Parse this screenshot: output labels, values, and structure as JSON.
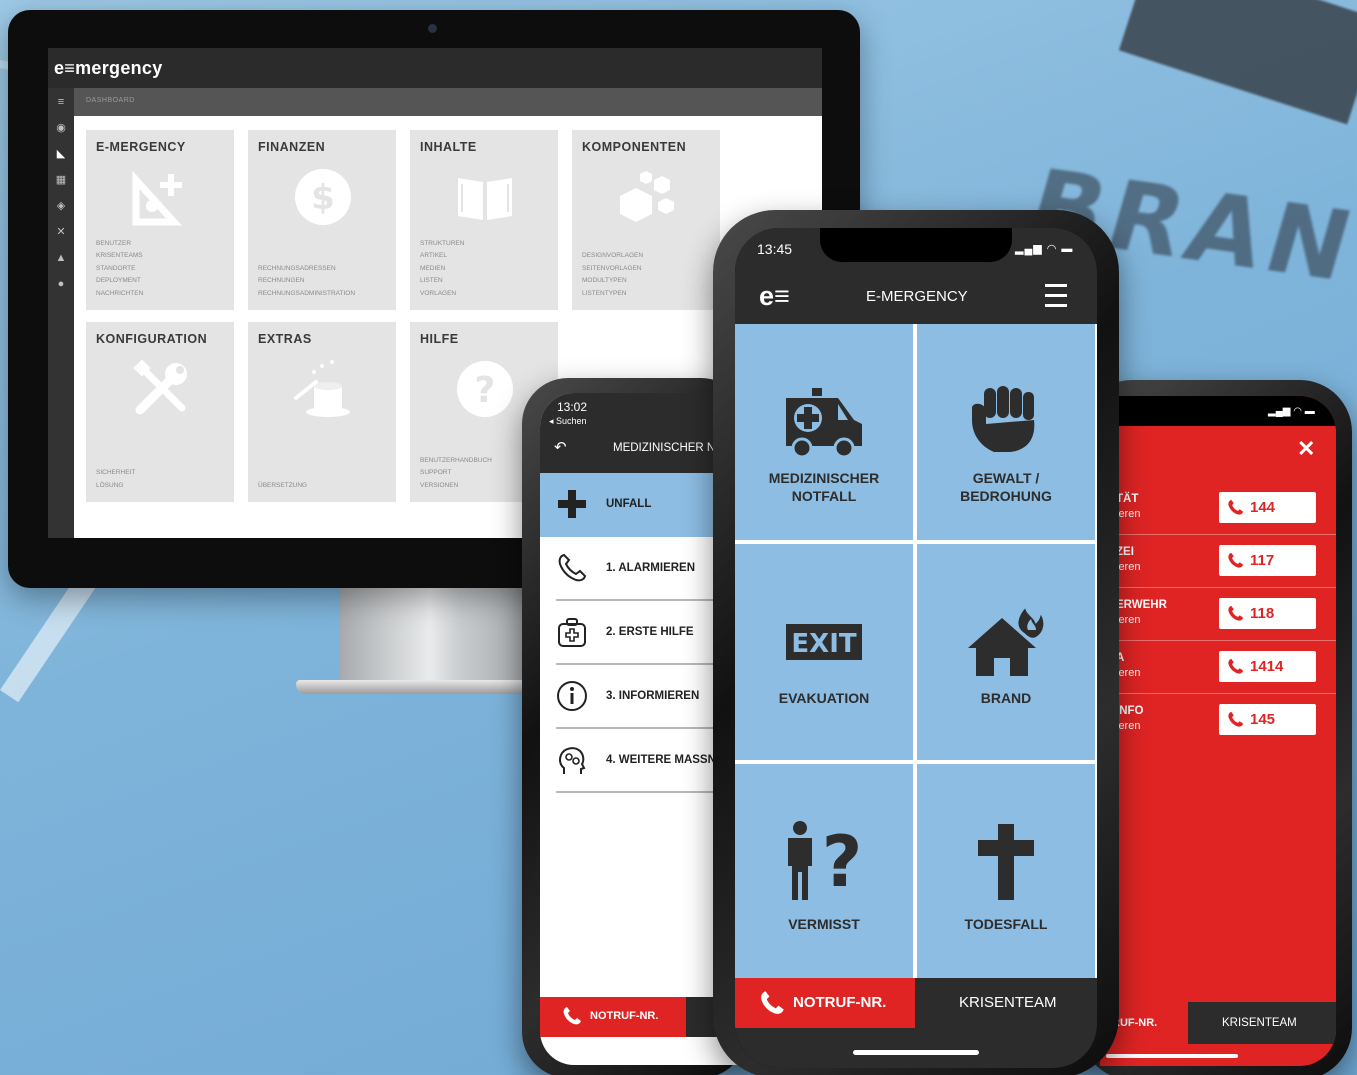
{
  "background": {
    "sign_text": "BRAN"
  },
  "desktop": {
    "logo": "e≡mergency",
    "breadcrumb": "DASHBOARD",
    "tiles": [
      {
        "title": "E-MERGENCY",
        "icon": "user-plus-icon",
        "links": [
          "BENUTZER",
          "KRISENTEAMS",
          "STANDORTE",
          "DEPLOYMENT",
          "NACHRICHTEN"
        ]
      },
      {
        "title": "FINANZEN",
        "icon": "dollar-icon",
        "links": [
          "RECHNUNGSADRESSEN",
          "RECHNUNGEN",
          "RECHNUNGSADMINISTRATION"
        ]
      },
      {
        "title": "INHALTE",
        "icon": "book-icon",
        "links": [
          "STRUKTUREN",
          "ARTIKEL",
          "MEDIEN",
          "LISTEN",
          "VORLAGEN"
        ]
      },
      {
        "title": "KOMPONENTEN",
        "icon": "cubes-icon",
        "links": [
          "DESIGNVORLAGEN",
          "SEITENVORLAGEN",
          "MODULTYPEN",
          "LISTENTYPEN"
        ]
      },
      {
        "title": "KONFIGURATION",
        "icon": "tools-icon",
        "links": [
          "SICHERHEIT",
          "LÖSUNG"
        ]
      },
      {
        "title": "EXTRAS",
        "icon": "magic-hat-icon",
        "links": [
          "ÜBERSETZUNG"
        ]
      },
      {
        "title": "HILFE",
        "icon": "question-icon",
        "links": [
          "BENUTZERHANDBUCH",
          "SUPPORT",
          "VERSIONEN"
        ]
      }
    ]
  },
  "left_phone": {
    "time": "13:02",
    "back_label": "◂ Suchen",
    "title": "MEDIZINISCHER N",
    "rows": [
      {
        "label": "UNFALL",
        "icon": "plus-icon",
        "active": true
      },
      {
        "label": "1. ALARMIEREN",
        "icon": "phone-icon",
        "active": false
      },
      {
        "label": "2. ERSTE HILFE",
        "icon": "first-aid-kit-icon",
        "active": false
      },
      {
        "label": "3. INFORMIEREN",
        "icon": "info-icon",
        "active": false
      },
      {
        "label": "4. WEITERE MASSN",
        "icon": "head-gears-icon",
        "active": false
      }
    ],
    "footer_notruf": "NOTRUF-NR."
  },
  "center_phone": {
    "time": "13:45",
    "logo": "e≡",
    "title": "E-MERGENCY",
    "cells": [
      {
        "label_1": "MEDIZINISCHER",
        "label_2": "NOTFALL",
        "icon": "ambulance-icon"
      },
      {
        "label_1": "GEWALT /",
        "label_2": "BEDROHUNG",
        "icon": "fist-icon"
      },
      {
        "label_1": "EVAKUATION",
        "label_2": "",
        "icon": "exit-sign-icon"
      },
      {
        "label_1": "BRAND",
        "label_2": "",
        "icon": "house-fire-icon"
      },
      {
        "label_1": "VERMISST",
        "label_2": "",
        "icon": "person-question-icon"
      },
      {
        "label_1": "TODESFALL",
        "label_2": "",
        "icon": "cross-icon"
      }
    ],
    "exit_text": "EXIT",
    "footer_notruf": "NOTRUF-NR.",
    "footer_krisenteam": "KRISENTEAM"
  },
  "right_phone": {
    "close_label": "✕",
    "rows": [
      {
        "name": "TÄT",
        "sub": "ieren",
        "number": "144"
      },
      {
        "name": "ZEI",
        "sub": "ieren",
        "number": "117"
      },
      {
        "name": "ERWEHR",
        "sub": "ieren",
        "number": "118"
      },
      {
        "name": "A",
        "sub": "ieren",
        "number": "1414"
      },
      {
        "name": "INFO",
        "sub": "ieren",
        "number": "145"
      }
    ],
    "footer_left": "RUF-NR.",
    "footer_right": "KRISENTEAM"
  },
  "colors": {
    "accent_blue": "#8dbde2",
    "alarm_red": "#e02424",
    "dark": "#2c2c2c"
  }
}
